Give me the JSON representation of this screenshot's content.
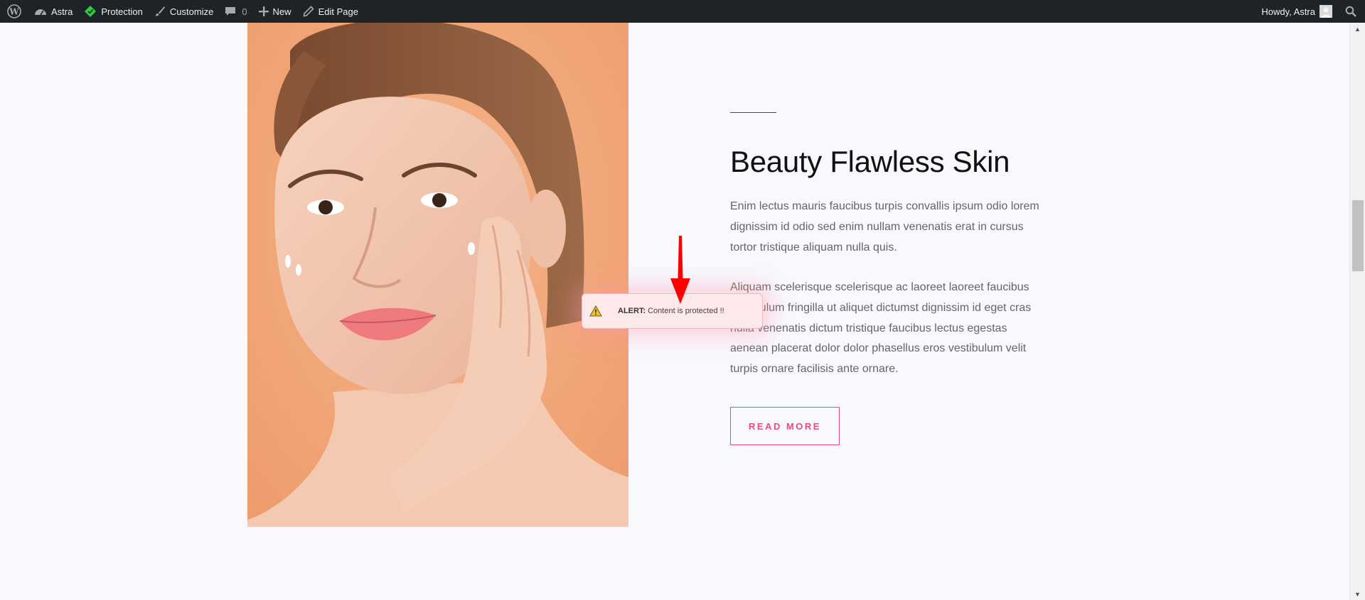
{
  "admin_bar": {
    "site_name": "Astra",
    "protection": "Protection",
    "customize": "Customize",
    "comments_count": "0",
    "new": "New",
    "edit_page": "Edit Page",
    "howdy": "Howdy, Astra"
  },
  "icons": {
    "wordpress": "wordpress-logo-icon",
    "dashboard": "dashboard-gauge-icon",
    "protection": "shield-tag-icon",
    "customize": "paintbrush-icon",
    "comments": "speech-bubble-icon",
    "new": "plus-icon",
    "edit": "pencil-icon",
    "search": "search-icon",
    "alert": "warning-triangle-icon"
  },
  "content": {
    "heading": "Beauty Flawless Skin",
    "paragraph1": "Enim lectus mauris faucibus turpis convallis ipsum odio lorem dignissim id odio sed enim nullam venenatis erat in cursus tortor tristique aliquam nulla quis.",
    "paragraph2": "Aliquam scelerisque scelerisque ac laoreet laoreet faucibus vestibulum fringilla ut aliquet dictumst dignissim id eget cras nulla venenatis dictum tristique faucibus lectus egestas aenean placerat dolor dolor phasellus eros vestibulum velit turpis ornare facilisis ante ornare.",
    "button_label": "READ MORE"
  },
  "alert": {
    "label": "ALERT:",
    "message": "Content is protected !!"
  },
  "colors": {
    "admin_bar_bg": "#1d2327",
    "accent": "#e74c7f",
    "page_bg": "#f8f8fd",
    "alert_bg": "#fde9ea",
    "arrow": "#ff0000",
    "protection_green": "#2ecc40"
  }
}
